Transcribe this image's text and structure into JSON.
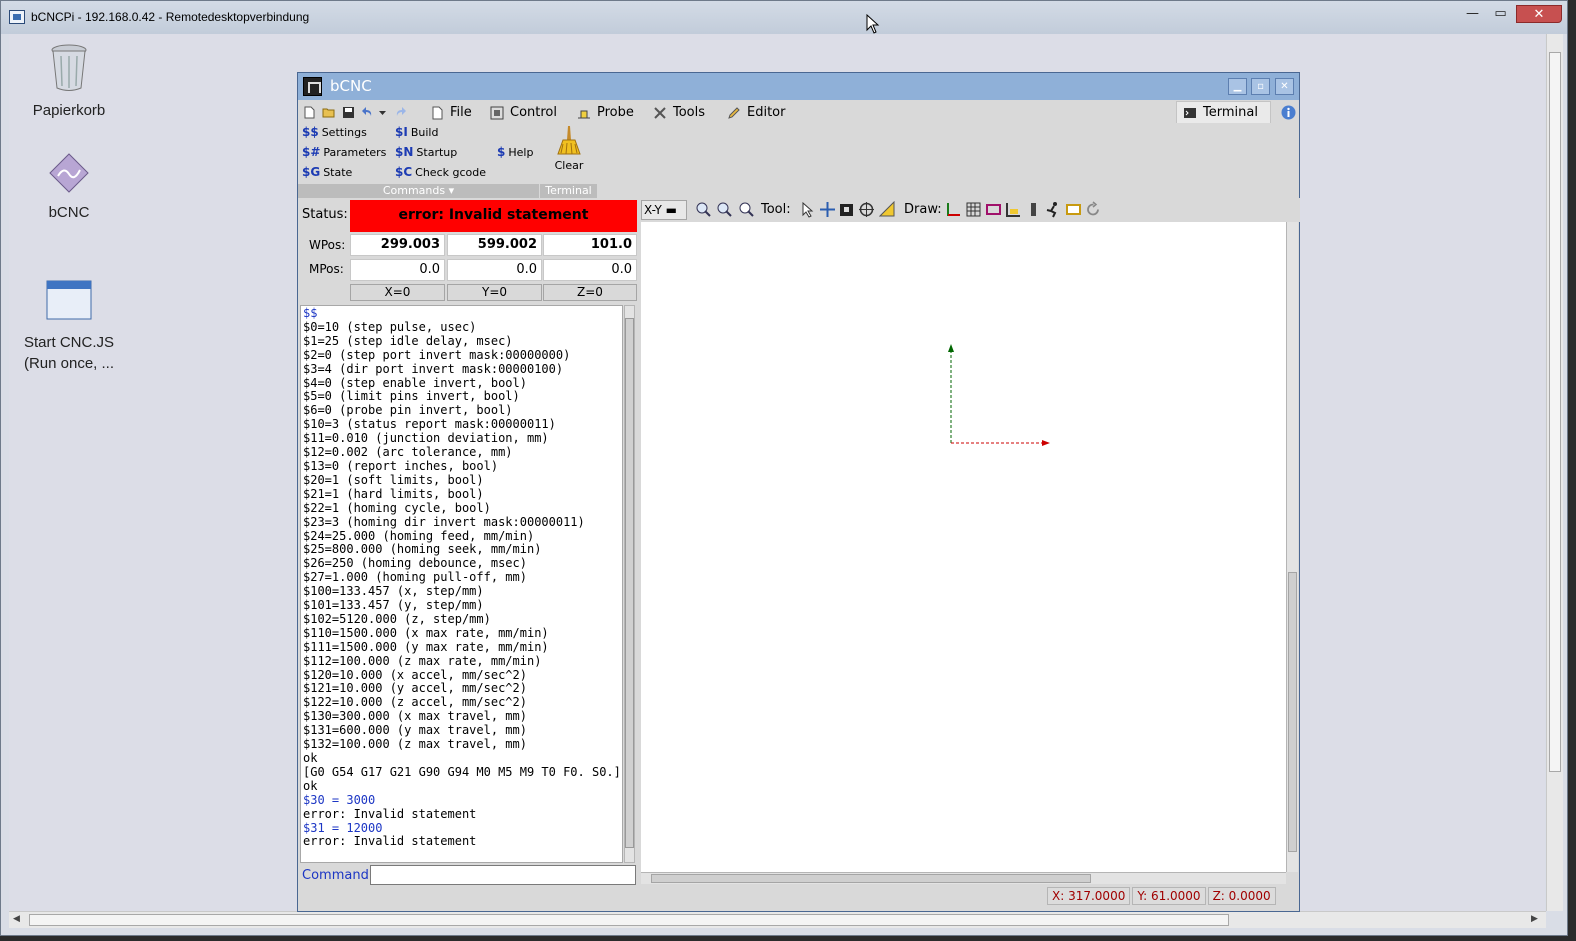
{
  "rdp": {
    "title": "bCNCPi - 192.168.0.42 - Remotedesktopverbindung",
    "minimize": "—",
    "maximize": "▭",
    "close": "✕"
  },
  "desktop_icons": [
    {
      "label": "Papierkorb"
    },
    {
      "label": "bCNC"
    },
    {
      "label": "Start CNC.JS\n(Run once, ..."
    }
  ],
  "bcnc": {
    "title": "bCNC",
    "menu": {
      "file": "File",
      "control": "Control",
      "probe": "Probe",
      "tools": "Tools",
      "editor": "Editor",
      "terminal": "Terminal"
    },
    "ribbon": {
      "settings": {
        "prefix": "$$",
        "label": "Settings"
      },
      "parameters": {
        "prefix": "$#",
        "label": "Parameters"
      },
      "state": {
        "prefix": "$G",
        "label": "State"
      },
      "build": {
        "prefix": "$I",
        "label": "Build"
      },
      "startup": {
        "prefix": "$N",
        "label": "Startup"
      },
      "check_gcode": {
        "prefix": "$C",
        "label": "Check gcode"
      },
      "help": {
        "prefix": "$",
        "label": "Help"
      },
      "clear": "Clear",
      "commands_group": "Commands ▾",
      "terminal_group": "Terminal"
    },
    "status": {
      "label": "Status:",
      "value": "error: Invalid statement"
    },
    "wpos": {
      "label": "WPos:",
      "x": "299.003",
      "y": "599.002",
      "z": "101.0"
    },
    "mpos": {
      "label": "MPos:",
      "x": "0.0",
      "y": "0.0",
      "z": "0.0"
    },
    "zero_buttons": {
      "x": "X=0",
      "y": "Y=0",
      "z": "Z=0"
    },
    "terminal_lines": [
      {
        "text": "$$",
        "color": "blue"
      },
      {
        "text": "$0=10 (step pulse, usec)"
      },
      {
        "text": "$1=25 (step idle delay, msec)"
      },
      {
        "text": "$2=0 (step port invert mask:00000000)"
      },
      {
        "text": "$3=4 (dir port invert mask:00000100)"
      },
      {
        "text": "$4=0 (step enable invert, bool)"
      },
      {
        "text": "$5=0 (limit pins invert, bool)"
      },
      {
        "text": "$6=0 (probe pin invert, bool)"
      },
      {
        "text": "$10=3 (status report mask:00000011)"
      },
      {
        "text": "$11=0.010 (junction deviation, mm)"
      },
      {
        "text": "$12=0.002 (arc tolerance, mm)"
      },
      {
        "text": "$13=0 (report inches, bool)"
      },
      {
        "text": "$20=1 (soft limits, bool)"
      },
      {
        "text": "$21=1 (hard limits, bool)"
      },
      {
        "text": "$22=1 (homing cycle, bool)"
      },
      {
        "text": "$23=3 (homing dir invert mask:00000011)"
      },
      {
        "text": "$24=25.000 (homing feed, mm/min)"
      },
      {
        "text": "$25=800.000 (homing seek, mm/min)"
      },
      {
        "text": "$26=250 (homing debounce, msec)"
      },
      {
        "text": "$27=1.000 (homing pull-off, mm)"
      },
      {
        "text": "$100=133.457 (x, step/mm)"
      },
      {
        "text": "$101=133.457 (y, step/mm)"
      },
      {
        "text": "$102=5120.000 (z, step/mm)"
      },
      {
        "text": "$110=1500.000 (x max rate, mm/min)"
      },
      {
        "text": "$111=1500.000 (y max rate, mm/min)"
      },
      {
        "text": "$112=100.000 (z max rate, mm/min)"
      },
      {
        "text": "$120=10.000 (x accel, mm/sec^2)"
      },
      {
        "text": "$121=10.000 (y accel, mm/sec^2)"
      },
      {
        "text": "$122=10.000 (z accel, mm/sec^2)"
      },
      {
        "text": "$130=300.000 (x max travel, mm)"
      },
      {
        "text": "$131=600.000 (y max travel, mm)"
      },
      {
        "text": "$132=100.000 (z max travel, mm)"
      },
      {
        "text": "ok"
      },
      {
        "text": "[G0 G54 G17 G21 G90 G94 M0 M5 M9 T0 F0. S0.]"
      },
      {
        "text": "ok"
      },
      {
        "text": "$30 = 3000",
        "color": "blue"
      },
      {
        "text": "error: Invalid statement"
      },
      {
        "text": "$31 = 12000",
        "color": "blue"
      },
      {
        "text": "error: Invalid statement"
      }
    ],
    "command": {
      "label": "Command:",
      "value": ""
    },
    "canvas_toolbar": {
      "view": "X-Y",
      "tool_label": "Tool:",
      "draw_label": "Draw:"
    },
    "coords": {
      "x": "X: 317.0000",
      "y": "Y: 61.0000",
      "z": "Z: 0.0000"
    },
    "colors": {
      "status_error": "#ff0000",
      "title_bar": "#8fb0d8",
      "axis_x": "#cc0000",
      "axis_y": "#006600"
    }
  }
}
